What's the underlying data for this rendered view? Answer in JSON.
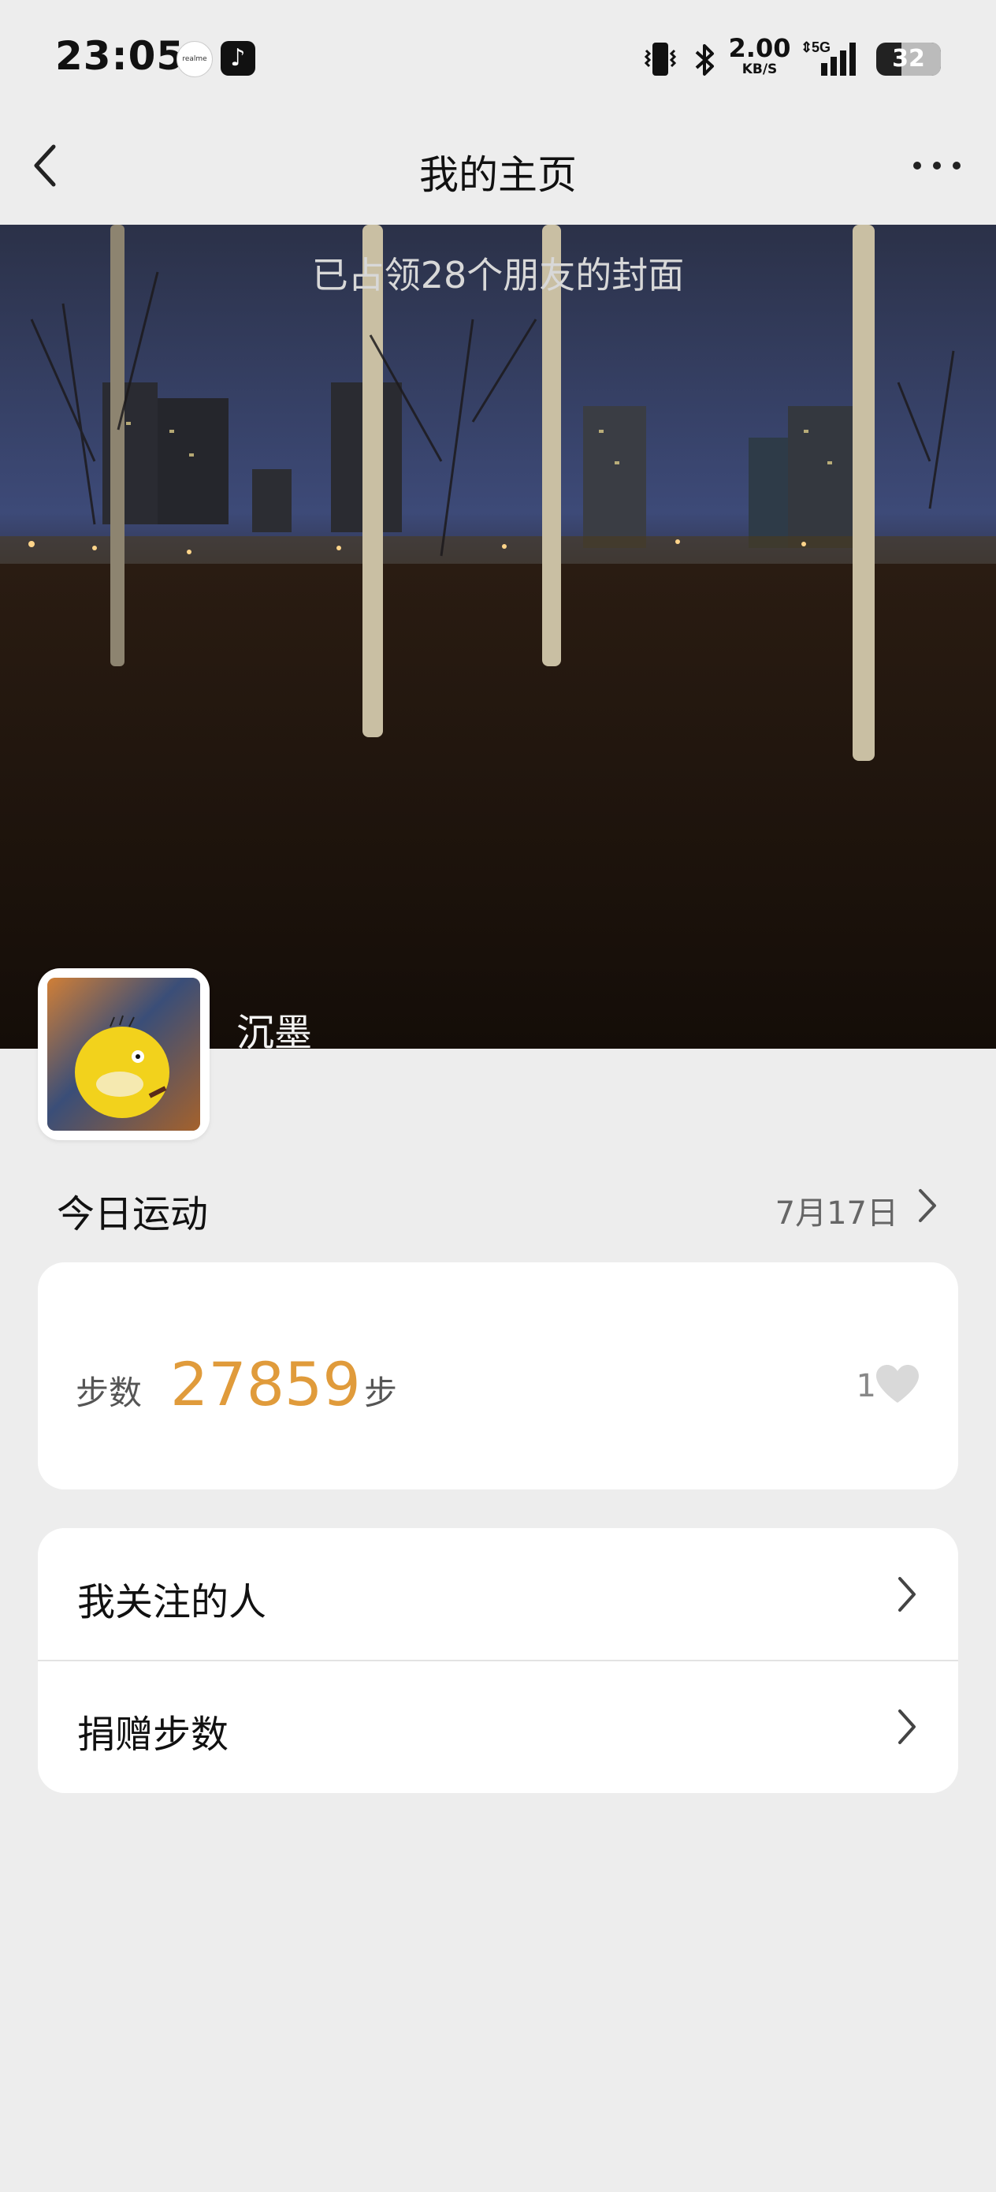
{
  "status_bar": {
    "time": "23:05",
    "app_icons": [
      "realme-icon",
      "tiktok-icon"
    ],
    "net_speed_value": "2.00",
    "net_speed_unit": "KB/S",
    "network_type": "5G",
    "battery": "32"
  },
  "header": {
    "title": "我的主页",
    "back_icon": "chevron-left-icon",
    "more_icon": "more-horizontal-icon"
  },
  "cover": {
    "caption": "已占领28个朋友的封面",
    "username": "沉墨"
  },
  "today": {
    "title": "今日运动",
    "date": "7月17日"
  },
  "steps": {
    "label": "步数",
    "value": "27859",
    "unit": "步",
    "likes": "1"
  },
  "menu": {
    "items": [
      {
        "label": "我关注的人"
      },
      {
        "label": "捐赠步数"
      }
    ]
  },
  "colors": {
    "accent": "#e09b3b",
    "background": "#ededed",
    "card": "#ffffff"
  }
}
